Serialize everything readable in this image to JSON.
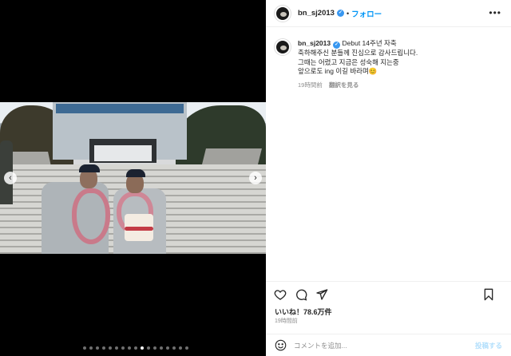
{
  "post": {
    "username": "bn_sj2013",
    "separator": "•",
    "follow_label": "フォロー",
    "more_icon": "more-horizontal-icon",
    "caption_lines": [
      "Debut 14주년 자축",
      "축하해주신 분들께 진심으로 감사드립니다.",
      "그때는 어렸고 지금은 성숙해 지는중",
      "앞으로도 ing 이길 바라며😊"
    ],
    "caption_time": "19時間前",
    "translate_label": "翻訳を見る",
    "likes_text": "いいね！78.6万件",
    "time_text": "19時間前",
    "comment_placeholder": "コメントを追加...",
    "post_label": "投稿する"
  },
  "media": {
    "image_count": 17,
    "active_index": 9,
    "prev_icon": "chevron-left-icon",
    "next_icon": "chevron-right-icon"
  },
  "icons": {
    "like": "heart-icon",
    "comment": "comment-icon",
    "share": "send-icon",
    "save": "bookmark-icon",
    "emoji": "emoji-icon"
  },
  "colors": {
    "link": "#0095f6",
    "verified": "#3897f0",
    "muted": "#8e8e8e"
  }
}
